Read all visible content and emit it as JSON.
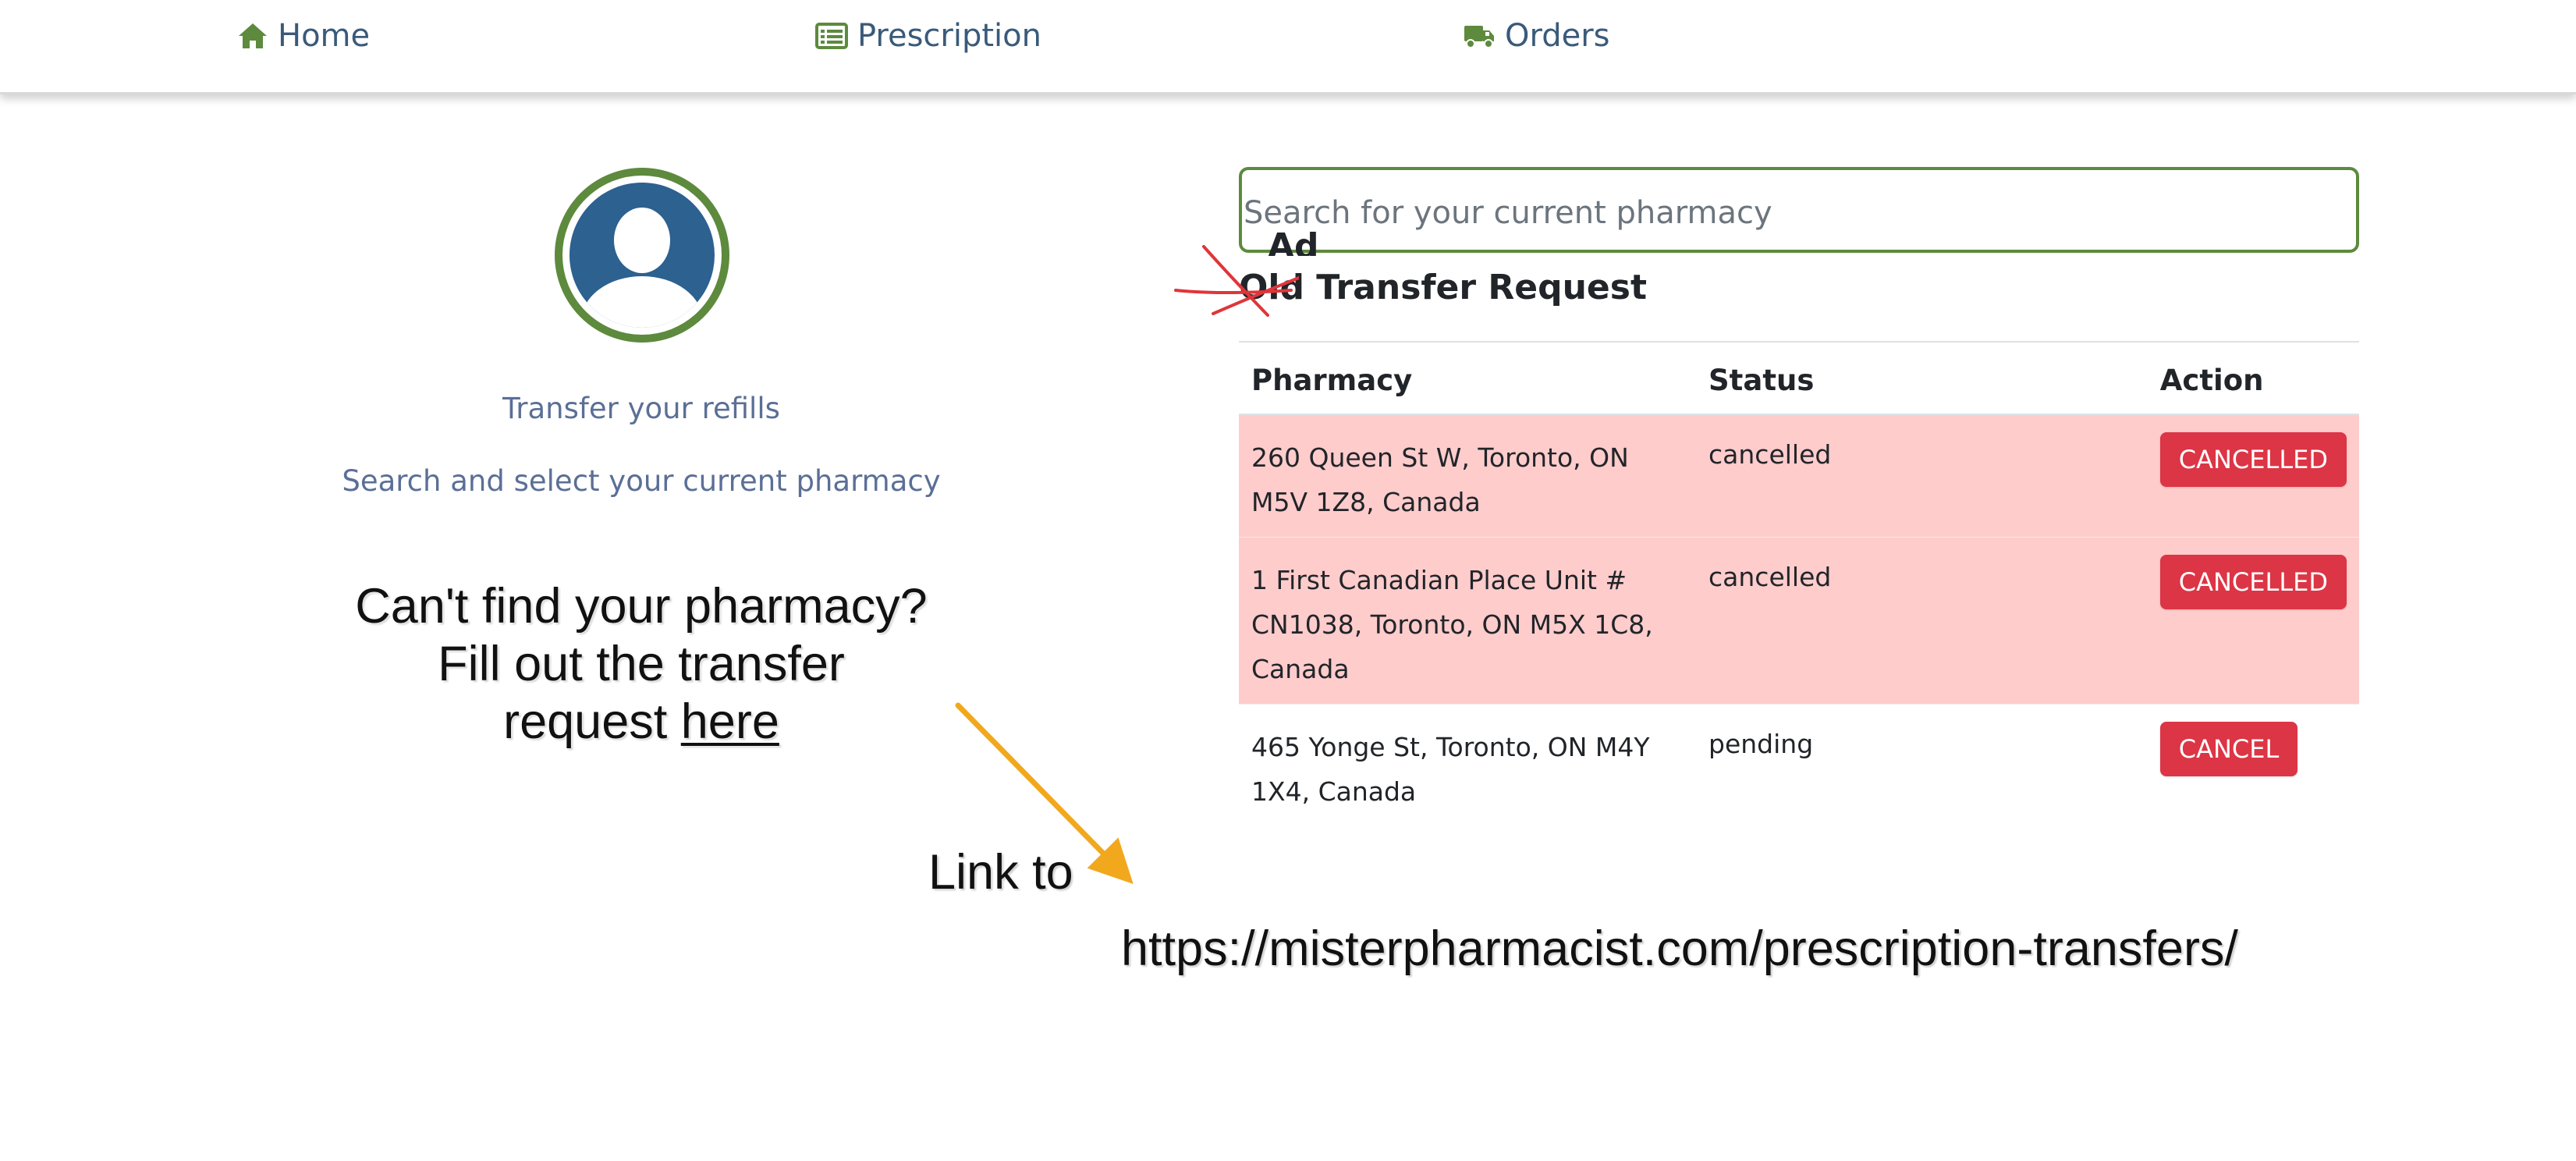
{
  "nav": {
    "items": [
      {
        "label": "Home",
        "icon": "home-icon"
      },
      {
        "label": "Prescription",
        "icon": "prescription-list-icon"
      },
      {
        "label": "Orders",
        "icon": "truck-icon"
      }
    ],
    "icon_color": "#5d8a3d"
  },
  "left": {
    "avatar_icon": "user-avatar-icon",
    "transfer_text": "Transfer your refills",
    "search_text": "Search and select your current pharmacy"
  },
  "search": {
    "placeholder": "Search for your current pharmacy",
    "value": ""
  },
  "table": {
    "heading": "Old Transfer Request",
    "heading_overlap_text": "Ad",
    "columns": [
      "Pharmacy",
      "Status",
      "Action"
    ],
    "rows": [
      {
        "pharmacy": "260 Queen St W, Toronto, ON M5V 1Z8, Canada",
        "status": "cancelled",
        "action": "CANCELLED",
        "row_color": "#ffcccc"
      },
      {
        "pharmacy": "1 First Canadian Place Unit # CN1038, Toronto, ON M5X 1C8, Canada",
        "status": "cancelled",
        "action": "CANCELLED",
        "row_color": "#ffcccc"
      },
      {
        "pharmacy": "465 Yonge St, Toronto, ON M4Y 1X4, Canada",
        "status": "pending",
        "action": "CANCEL",
        "row_color": "#ffffff"
      }
    ],
    "button_color": "#dc3545"
  },
  "annotations": {
    "cant_find_line1": "Can't find your pharmacy?",
    "cant_find_line2": "Fill out the transfer",
    "cant_find_line3_prefix": "request ",
    "cant_find_link": "here",
    "link_to": "Link to",
    "url": "https://misterpharmacist.com/prescription-transfers/",
    "arrow_color": "#f2a81d",
    "strike_color": "#e0353a"
  },
  "colors": {
    "brand_green": "#5d8a3d",
    "avatar_blue": "#2c6190",
    "muted_text": "#5b6f96"
  }
}
